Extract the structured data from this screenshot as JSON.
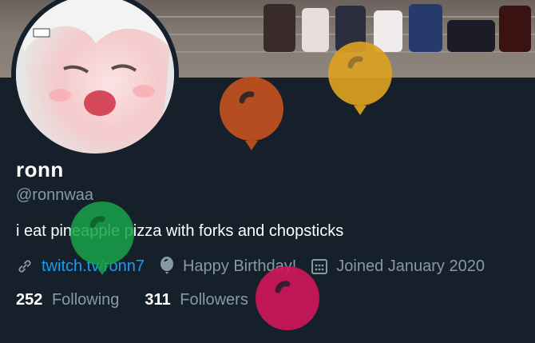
{
  "profile": {
    "display_name": "ronn",
    "handle": "@ronnwaa",
    "bio": "i eat pineapple pizza with forks and chopsticks",
    "website": "twitch.tv/ronn7",
    "birthday": "Happy Birthday!",
    "joined": "Joined January 2020"
  },
  "stats": {
    "following_count": "252",
    "following_label": "Following",
    "followers_count": "311",
    "followers_label": "Followers"
  },
  "icons": {
    "website": "link-icon",
    "birthday": "balloon-icon",
    "joined": "calendar-icon"
  },
  "colors": {
    "background": "#15202b",
    "link": "#1d9bf0",
    "secondary_text": "#8899a6",
    "balloon_orange": "#c4511f",
    "balloon_gold": "#dba122",
    "balloon_green": "#17a34a",
    "balloon_magenta": "#d1165b"
  }
}
